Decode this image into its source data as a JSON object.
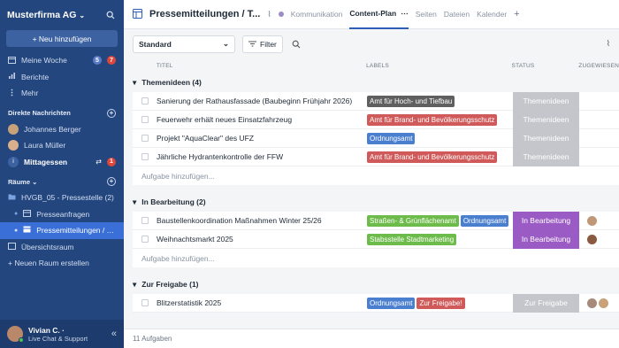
{
  "sidebar": {
    "org_name": "Musterfirma AG",
    "new_button": "+ Neu hinzufügen",
    "nav": [
      {
        "label": "Meine Woche",
        "badges": [
          "5",
          "7"
        ]
      },
      {
        "label": "Berichte"
      },
      {
        "label": "Mehr"
      }
    ],
    "dm_section": "Direkte Nachrichten",
    "dms": [
      {
        "label": "Johannes Berger"
      },
      {
        "label": "Laura Müller"
      },
      {
        "label": "Mittagessen",
        "badge": "1"
      }
    ],
    "rooms_section": "Räume",
    "rooms": [
      {
        "label": "HVGB_05 - Pressestelle (2)"
      },
      {
        "label": "Presseanfragen"
      },
      {
        "label": "Pressemitteilungen / Th..."
      },
      {
        "label": "Übersichtsraum"
      },
      {
        "label": "+ Neuen Raum erstellen"
      }
    ],
    "user_name": "Vivian C. ·",
    "user_sub": "Live Chat & Support"
  },
  "header": {
    "title": "Pressemitteilungen / T...",
    "tabs": [
      "Kommunikation",
      "Content-Plan",
      "Seiten",
      "Dateien",
      "Kalender"
    ],
    "active_tab": "Content-Plan"
  },
  "toolbar": {
    "view_select": "Standard",
    "filter_label": "Filter"
  },
  "columns": {
    "title": "TITEL",
    "labels": "LABELS",
    "status": "STATUS",
    "assignee": "ZUGEWIESEN"
  },
  "groups": [
    {
      "name": "Themenideen (4)",
      "status_color": "#c4c6cc",
      "rows": [
        {
          "title": "Sanierung der Rathausfassade (Baubeginn Frühjahr 2026)",
          "labels": [
            {
              "text": "Amt für Hoch- und Tiefbau",
              "color": "#5f5f5f"
            }
          ],
          "status": "Themenideen"
        },
        {
          "title": "Feuerwehr erhält neues Einsatzfahrzeug",
          "labels": [
            {
              "text": "Amt für Brand- und Bevölkerungsschutz",
              "color": "#d05a5a"
            }
          ],
          "status": "Themenideen"
        },
        {
          "title": "Projekt \"AquaClear\" des UFZ",
          "labels": [
            {
              "text": "Ordnungsamt",
              "color": "#4a7fd0"
            }
          ],
          "status": "Themenideen"
        },
        {
          "title": "Jährliche Hydrantenkontrolle der FFW",
          "labels": [
            {
              "text": "Amt für Brand- und Bevölkerungsschutz",
              "color": "#d05a5a"
            }
          ],
          "status": "Themenideen"
        }
      ],
      "add": "Aufgabe hinzufügen..."
    },
    {
      "name": "In Bearbeitung (2)",
      "status_color": "#9b5bc4",
      "rows": [
        {
          "title": "Baustellenkoordination Maßnahmen Winter 25/26",
          "labels": [
            {
              "text": "Straßen- & Grünflächenamt",
              "color": "#6dbb4a"
            },
            {
              "text": "Ordnungsamt",
              "color": "#4a7fd0"
            }
          ],
          "status": "In Bearbeitung",
          "avatars": 1
        },
        {
          "title": "Weihnachtsmarkt 2025",
          "labels": [
            {
              "text": "Stabsstelle Stadtmarketing",
              "color": "#6dbb4a"
            }
          ],
          "status": "In Bearbeitung",
          "avatars": 1
        }
      ],
      "add": "Aufgabe hinzufügen..."
    },
    {
      "name": "Zur Freigabe (1)",
      "status_color": "#c4c6cc",
      "rows": [
        {
          "title": "Blitzerstatistik 2025",
          "labels": [
            {
              "text": "Ordnungsamt",
              "color": "#4a7fd0"
            },
            {
              "text": "Zur Freigabe!",
              "color": "#d05a5a"
            }
          ],
          "status": "Zur Freigabe",
          "avatars": 2
        }
      ]
    }
  ],
  "footer": "11 Aufgaben"
}
